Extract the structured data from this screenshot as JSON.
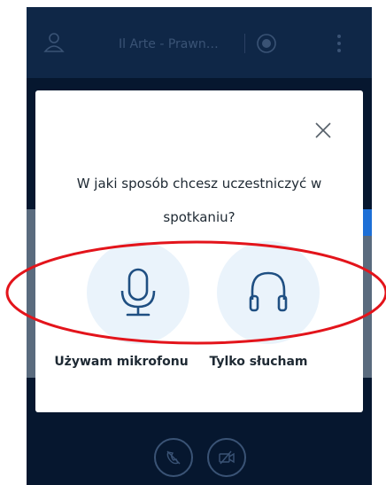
{
  "topbar": {
    "title": "Il Arte - Prawn…",
    "icons": [
      "user-icon",
      "record-icon",
      "more-vertical-icon"
    ]
  },
  "dialog": {
    "question": "W jaki sposób chcesz uczestniczyć w spotkaniu?",
    "close_icon": "close-icon",
    "options": [
      {
        "label": "Używam mikrofonu",
        "icon": "microphone-icon"
      },
      {
        "label": "Tylko słucham",
        "icon": "headphones-icon"
      }
    ]
  },
  "bottombar": {
    "icons": [
      "phone-off-icon",
      "video-off-icon"
    ]
  },
  "colors": {
    "background": "#06172f",
    "topbar": "#0f2747",
    "option_circle": "#eaf3fb",
    "icon_blue": "#1f4f82",
    "annotation_red": "#e3141b"
  }
}
